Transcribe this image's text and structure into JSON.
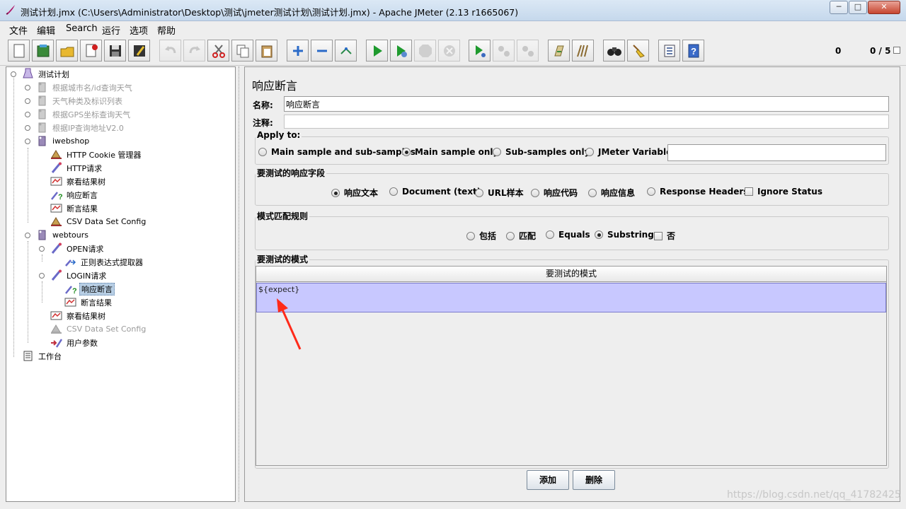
{
  "window": {
    "title": "测试计划.jmx (C:\\Users\\Administrator\\Desktop\\测试\\jmeter测试计划\\测试计划.jmx) - Apache JMeter (2.13 r1665067)",
    "min_label": "─",
    "max_label": "□",
    "close_label": "✕"
  },
  "menu": [
    "文件",
    "编辑",
    "Search",
    "运行",
    "选项",
    "帮助"
  ],
  "toolbar": {
    "error_count": "0",
    "threads": "0 / 5",
    "icons": [
      "new-icon",
      "templates-icon",
      "open-icon",
      "close-icon",
      "save-icon",
      "save-as-icon",
      "undo-icon",
      "redo-icon",
      "cut-icon",
      "copy-icon",
      "paste-icon",
      "expand-icon",
      "collapse-icon",
      "toggle-icon",
      "start-icon",
      "start-no-pause-icon",
      "stop-icon",
      "shutdown-icon",
      "remote-start-icon",
      "remote-stop-icon",
      "remote-exit-icon",
      "clear-icon",
      "clear-all-icon",
      "search-icon",
      "reset-search-icon",
      "function-helper-icon",
      "help-icon"
    ]
  },
  "tree": {
    "root": "测试计划",
    "items": [
      {
        "label": "根据城市名/id查询天气",
        "disabled": true
      },
      {
        "label": "天气种类及标识列表",
        "disabled": true
      },
      {
        "label": "根据GPS坐标查询天气",
        "disabled": true
      },
      {
        "label": "根据IP查询地址V2.0",
        "disabled": true
      },
      {
        "label": "iwebshop"
      },
      {
        "label": "HTTP Cookie 管理器"
      },
      {
        "label": "HTTP请求"
      },
      {
        "label": "察看结果树"
      },
      {
        "label": "响应断言"
      },
      {
        "label": "断言结果"
      },
      {
        "label": "CSV Data Set Config"
      },
      {
        "label": "webtours"
      },
      {
        "label": "OPEN请求"
      },
      {
        "label": "正则表达式提取器"
      },
      {
        "label": "LOGIN请求"
      },
      {
        "label": "响应断言",
        "selected": true
      },
      {
        "label": "断言结果"
      },
      {
        "label": "察看结果树"
      },
      {
        "label": "CSV Data Set Config",
        "disabled": true
      },
      {
        "label": "用户参数"
      },
      {
        "label": "工作台"
      }
    ]
  },
  "panel": {
    "title": "响应断言",
    "name_label": "名称:",
    "name_value": "响应断言",
    "comment_label": "注释:",
    "comment_value": "",
    "apply_to": {
      "title": "Apply to:",
      "options": [
        "Main sample and sub-samples",
        "Main sample only",
        "Sub-samples only",
        "JMeter Variable"
      ],
      "selected": "Main sample only",
      "variable_value": ""
    },
    "field": {
      "title": "要测试的响应字段",
      "options": [
        "响应文本",
        "Document (text)",
        "URL样本",
        "响应代码",
        "响应信息",
        "Response Headers"
      ],
      "selected": "响应文本",
      "ignore_status": "Ignore Status"
    },
    "rules": {
      "title": "模式匹配规则",
      "options": [
        "包括",
        "匹配",
        "Equals",
        "Substring"
      ],
      "selected": "Substring",
      "not_label": "否"
    },
    "patterns": {
      "title": "要测试的模式",
      "column": "要测试的模式",
      "rows": [
        "${expect}"
      ]
    },
    "add_button": "添加",
    "delete_button": "删除"
  },
  "watermark": "https://blog.csdn.net/qq_41782425",
  "colors": {
    "selected_row": "#c8c8ff",
    "annotation_arrow": "#ff2a1a"
  }
}
